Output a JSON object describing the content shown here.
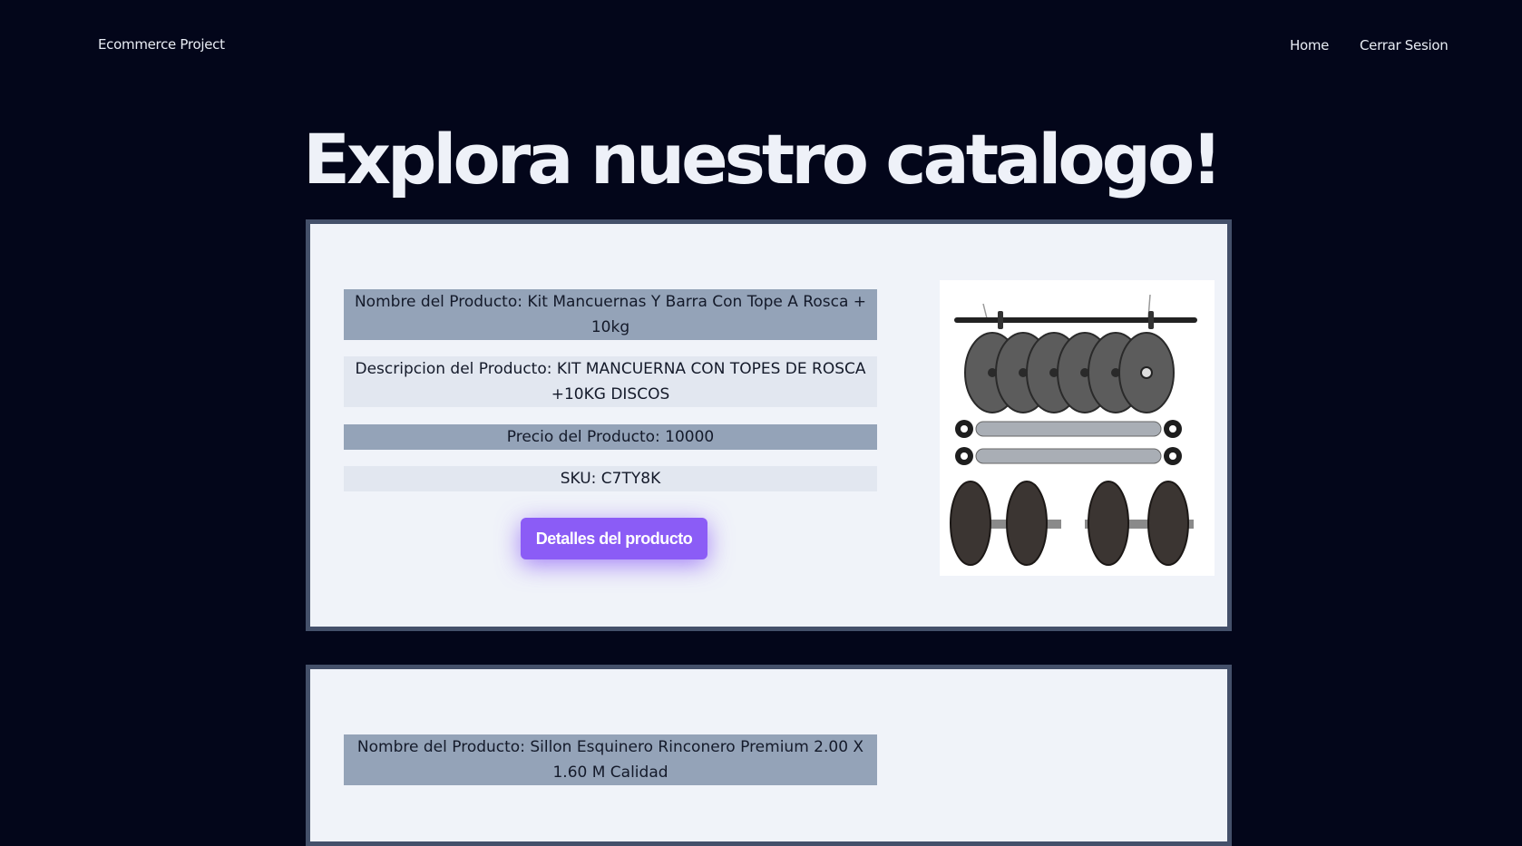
{
  "navbar": {
    "brand": "Ecommerce Project",
    "links": [
      "Home",
      "Cerrar Sesion"
    ]
  },
  "page": {
    "title": "Explora nuestro catalogo!"
  },
  "products": [
    {
      "name": "Nombre del Producto: Kit Mancuernas Y Barra Con Tope A Rosca + 10kg",
      "description": "Descripcion del Producto: KIT MANCUERNA CON TOPES DE ROSCA +10KG DISCOS",
      "price": "Precio del Producto: 10000",
      "sku": "SKU: C7TY8K",
      "button_label": "Detalles del producto",
      "image_icon": "dumbbell-kit-image"
    },
    {
      "name": "Nombre del Producto: Sillon Esquinero Rinconero Premium 2.00 X 1.60 M Calidad"
    }
  ],
  "colors": {
    "background": "#03061a",
    "card": "#f0f3f9",
    "card_border": "#44506a",
    "row_dark": "#94a3b8",
    "row_light": "#e2e7f0",
    "button": "#8b5cf6"
  }
}
